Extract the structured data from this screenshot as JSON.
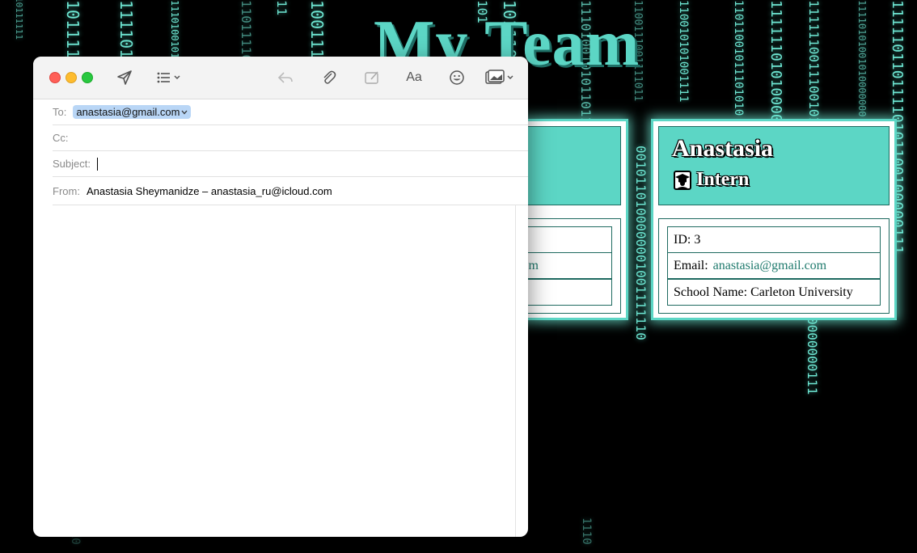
{
  "background": {
    "binary_columns": [
      "10111111",
      "1111010",
      "11101001010000000",
      "110111101",
      "10111",
      "10011100",
      "101",
      "11",
      "10111011",
      "1110100101011011100",
      "1100111001111011",
      "110010101001111",
      "11011001011101010",
      "111111010100000000",
      "11111100111001011",
      "11110101001010000000",
      "1000111111101101001",
      "11101011011010100000111",
      "11111011011110101100100000111",
      "0010110100000001001111110",
      "111000001111111101000000111",
      "0000000111",
      "1110"
    ],
    "title": "My Team"
  },
  "cards": [
    {
      "name": "Anastasia",
      "role": "Intern",
      "role_icon": "graduate-icon",
      "id_text": "ID: 3",
      "email_label": "Email:",
      "email": "anastasia@gmail.com",
      "school_text": "School Name: Carleton University"
    }
  ],
  "partial_card": {
    "email_fragment": "m"
  },
  "mail": {
    "toolbar_icons": [
      "send-icon",
      "format-list-icon",
      "reply-icon",
      "attachment-icon",
      "markup-icon",
      "font-icon",
      "emoji-icon",
      "photo-browser-icon"
    ],
    "font_button_label": "Aa",
    "to_label": "To:",
    "to_value": "anastasia@gmail.com",
    "cc_label": "Cc:",
    "subject_label": "Subject:",
    "subject_value": "",
    "from_label": "From:",
    "from_value": "Anastasia Sheymanidze – anastasia_ru@icloud.com"
  },
  "colors": {
    "accent": "#5cd6c5",
    "link": "#1f7a6d",
    "close": "#ff5f57",
    "minimize": "#febc2e",
    "zoom": "#28c840"
  }
}
